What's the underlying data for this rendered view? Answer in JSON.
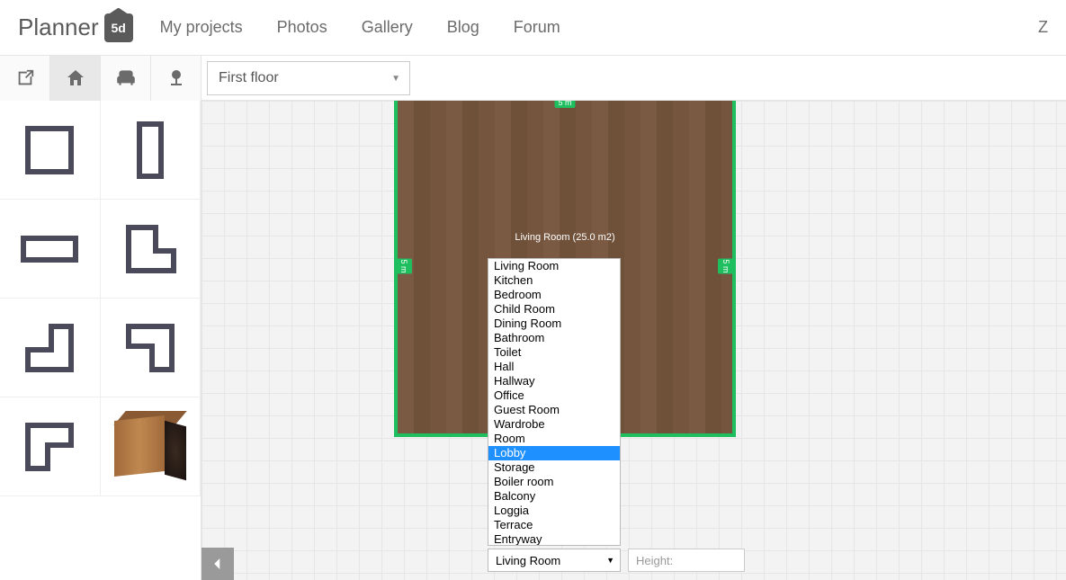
{
  "app": {
    "name": "Planner",
    "badge": "5d"
  },
  "nav": {
    "links": [
      "My projects",
      "Photos",
      "Gallery",
      "Blog",
      "Forum"
    ],
    "right": "Z"
  },
  "floor_selector": {
    "value": "First floor"
  },
  "room": {
    "label": "Living Room (25.0 m2)",
    "dim_top": "5 m",
    "dim_side": "5 m"
  },
  "room_types": [
    "Living Room",
    "Kitchen",
    "Bedroom",
    "Child Room",
    "Dining Room",
    "Bathroom",
    "Toilet",
    "Hall",
    "Hallway",
    "Office",
    "Guest Room",
    "Wardrobe",
    "Room",
    "Lobby",
    "Storage",
    "Boiler room",
    "Balcony",
    "Loggia",
    "Terrace",
    "Entryway"
  ],
  "room_type_selected_index": 13,
  "room_type_select_value": "Living Room",
  "height_label": "Height:"
}
